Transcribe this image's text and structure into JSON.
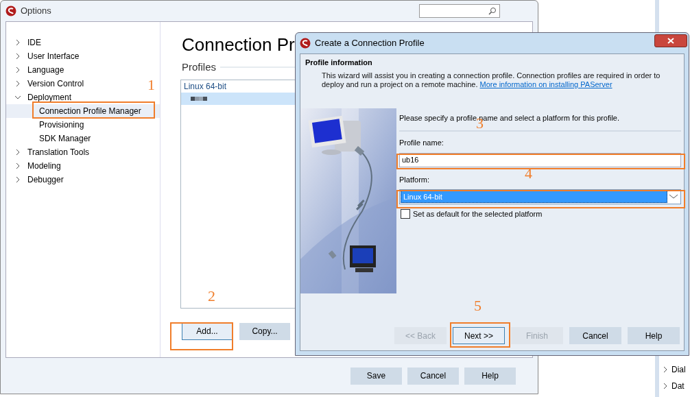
{
  "options_window": {
    "title": "Options",
    "tree": [
      {
        "label": "IDE",
        "expanded": false,
        "selected": false
      },
      {
        "label": "User Interface",
        "expanded": false,
        "selected": false
      },
      {
        "label": "Language",
        "expanded": false,
        "selected": false
      },
      {
        "label": "Version Control",
        "expanded": false,
        "selected": false
      },
      {
        "label": "Deployment",
        "expanded": true,
        "selected": false,
        "children": [
          {
            "label": "Connection Profile Manager",
            "selected": true
          },
          {
            "label": "Provisioning",
            "selected": false
          },
          {
            "label": "SDK Manager",
            "selected": false
          }
        ]
      },
      {
        "label": "Translation Tools",
        "expanded": false,
        "selected": false
      },
      {
        "label": "Modeling",
        "expanded": false,
        "selected": false
      },
      {
        "label": "Debugger",
        "expanded": false,
        "selected": false
      }
    ],
    "heading": "Connection Pr",
    "profiles_label": "Profiles",
    "profiles": [
      {
        "kind": "group",
        "label": "Linux 64-bit",
        "selected": false
      },
      {
        "kind": "redacted",
        "selected": true
      }
    ],
    "list_buttons": [
      {
        "label": "Add...",
        "focused": true
      },
      {
        "label": "Copy...",
        "focused": false
      }
    ],
    "footer_buttons": [
      {
        "label": "Save"
      },
      {
        "label": "Cancel"
      },
      {
        "label": "Help"
      }
    ]
  },
  "background_tree": [
    {
      "label": "Dial"
    },
    {
      "label": "Dat"
    }
  ],
  "dialog": {
    "title": "Create a Connection Profile",
    "section_title": "Profile information",
    "intro": "This wizard will assist you in creating a connection profile.  Connection profiles are required in order to deploy and run a project on a remote machine.",
    "link": "More information on installing PAServer",
    "instruction": "Please specify a profile name and select a platform for this profile.",
    "profile_name": {
      "label": "Profile name:",
      "value": "ub16"
    },
    "platform": {
      "label": "Platform:",
      "value": "Linux 64-bit"
    },
    "default_checkbox": {
      "label": "Set as default for the selected platform",
      "checked": false
    },
    "buttons": [
      {
        "label": "<< Back",
        "disabled": true,
        "focused": false
      },
      {
        "label": "Next >>",
        "disabled": false,
        "focused": true
      },
      {
        "label": "Finish",
        "disabled": true,
        "focused": false
      },
      {
        "label": "Cancel",
        "disabled": false,
        "focused": false
      },
      {
        "label": "Help",
        "disabled": false,
        "focused": false
      }
    ]
  },
  "annotations": [
    {
      "label": "1"
    },
    {
      "label": "2"
    },
    {
      "label": "3"
    },
    {
      "label": "4"
    },
    {
      "label": "5"
    }
  ]
}
